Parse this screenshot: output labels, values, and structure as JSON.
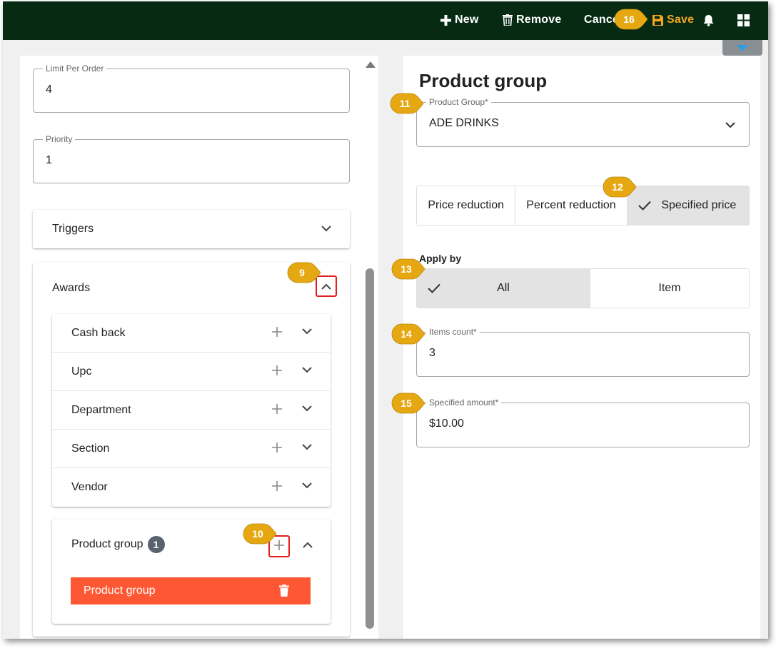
{
  "toolbar": {
    "new_label": "New",
    "remove_label": "Remove",
    "cancel_label": "Cancel",
    "save_label": "Save",
    "save_color": "#f6a623",
    "background": "#062b12"
  },
  "left": {
    "limit_per_order": {
      "label": "Limit Per Order",
      "value": "4"
    },
    "priority": {
      "label": "Priority",
      "value": "1"
    },
    "triggers": {
      "title": "Triggers"
    },
    "awards": {
      "title": "Awards",
      "items": [
        {
          "label": "Cash back"
        },
        {
          "label": "Upc"
        },
        {
          "label": "Department"
        },
        {
          "label": "Section"
        },
        {
          "label": "Vendor"
        }
      ],
      "product_group": {
        "label": "Product group",
        "count": "1",
        "entry": "Product group",
        "entry_color": "#fe5733"
      }
    }
  },
  "right": {
    "title": "Product group",
    "product_group_field": {
      "label": "Product Group*",
      "value": "ADE DRINKS"
    },
    "price_type": {
      "options": [
        "Price reduction",
        "Percent reduction",
        "Specified price"
      ],
      "selected": "Specified price"
    },
    "apply_by": {
      "label": "Apply by",
      "options": [
        "All",
        "Item"
      ],
      "selected": "All"
    },
    "items_count": {
      "label": "Items count*",
      "value": "3"
    },
    "specified_amount": {
      "label": "Specified amount*",
      "value": "$10.00"
    }
  },
  "callouts": {
    "c9": "9",
    "c10": "10",
    "c11": "11",
    "c12": "12",
    "c13": "13",
    "c14": "14",
    "c15": "15",
    "c16": "16",
    "color": "#e6a812"
  }
}
